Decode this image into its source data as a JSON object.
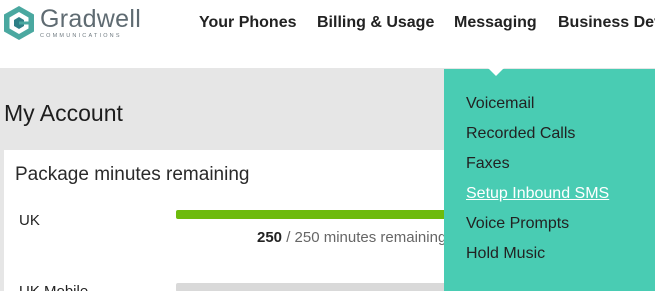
{
  "brand": {
    "name": "Gradwell",
    "tagline": "COMMUNICATIONS"
  },
  "nav": {
    "items": [
      "Your Phones",
      "Billing & Usage",
      "Messaging",
      "Business Dev"
    ]
  },
  "page": {
    "title": "My Account"
  },
  "package": {
    "title": "Package minutes remaining",
    "rows": [
      {
        "label": "UK",
        "remaining": "250",
        "caption": " / 250 minutes remaining",
        "fill": 1.0
      },
      {
        "label": "UK Mobile",
        "fill": 0.0
      }
    ]
  },
  "dropdown": {
    "items": [
      "Voicemail",
      "Recorded Calls",
      "Faxes",
      "Setup Inbound SMS",
      "Voice Prompts",
      "Hold Music"
    ],
    "active": "Setup Inbound SMS"
  },
  "colors": {
    "accent": "#49ccb3",
    "progress": "#6dbb0c",
    "logo": "#4aa8a0"
  }
}
